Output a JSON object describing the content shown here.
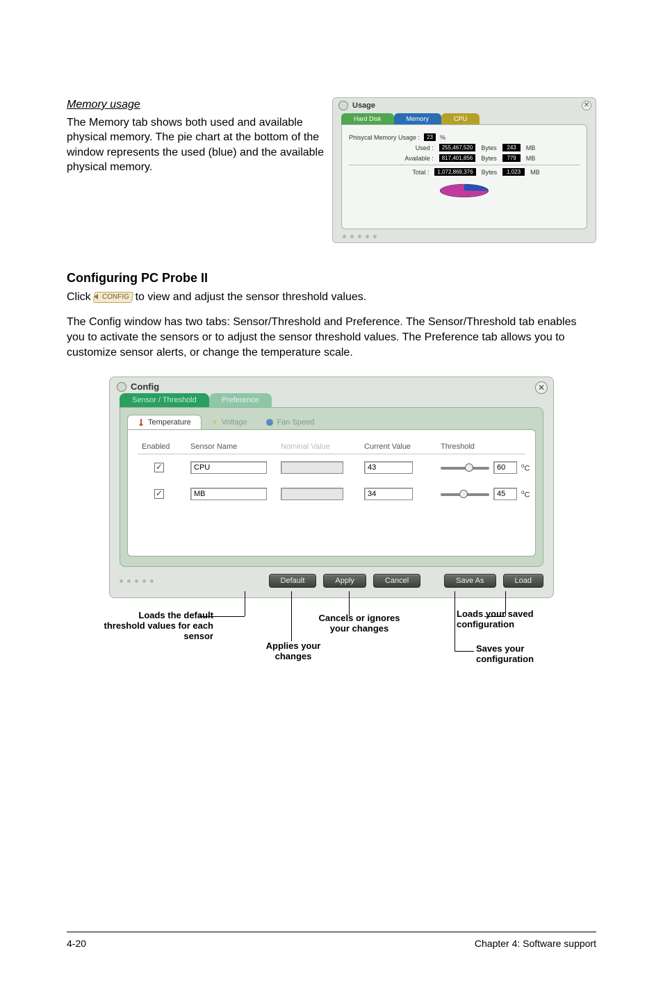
{
  "memory_section": {
    "heading": "Memory usage",
    "body": "The Memory tab shows both used and available physical memory. The pie chart at the bottom of the window represents the used (blue) and the available physical memory."
  },
  "usage_window": {
    "title": "Usage",
    "tabs": {
      "hard": "Hard Disk",
      "memory": "Memory",
      "cpu": "CPU"
    },
    "label_usage": "Phisycal Memory Usage :",
    "pct_box": "23",
    "pct_suffix": "%",
    "rows": {
      "used": {
        "label": "Used :",
        "bytes": "255,467,520",
        "unit1": "Bytes",
        "mb": "243",
        "unit2": "MB"
      },
      "available": {
        "label": "Available :",
        "bytes": "817,401,856",
        "unit1": "Bytes",
        "mb": "779",
        "unit2": "MB"
      },
      "total": {
        "label": "Total :",
        "bytes": "1,072,869,376",
        "unit1": "Bytes",
        "mb": "1,023",
        "unit2": "MB"
      }
    }
  },
  "configuring": {
    "heading": "Configuring PC Probe II",
    "click_pre": "Click",
    "config_btn": "CONFIG",
    "click_post": "to view and adjust the sensor threshold values.",
    "paragraph": "The Config window has two tabs: Sensor/Threshold and Preference. The Sensor/Threshold tab enables you to activate the sensors or to adjust the sensor threshold values. The Preference tab allows you to customize sensor alerts, or change the temperature scale."
  },
  "config_window": {
    "title": "Config",
    "outer_tabs": {
      "sensor": "Sensor / Threshold",
      "pref": "Preference"
    },
    "inner_tabs": {
      "temp": "Temperature",
      "volt": "Voltage",
      "fan": "Fan Speed"
    },
    "columns": {
      "enabled": "Enabled",
      "sensor": "Sensor Name",
      "nominal": "Nominal Value",
      "current": "Current Value",
      "threshold": "Threshold"
    },
    "rows": [
      {
        "name": "CPU",
        "current": "43",
        "threshold": "60",
        "unit": "C",
        "thumb_pct": 50
      },
      {
        "name": "MB",
        "current": "34",
        "threshold": "45",
        "unit": "C",
        "thumb_pct": 38
      }
    ],
    "buttons": {
      "default": "Default",
      "apply": "Apply",
      "cancel": "Cancel",
      "saveas": "Save As",
      "load": "Load"
    }
  },
  "annotations": {
    "loads_default": "Loads the default threshold values for each sensor",
    "applies": "Applies your changes",
    "cancels": "Cancels or ignores your changes",
    "loads_saved": "Loads your saved configuration",
    "saves": "Saves your configuration"
  },
  "footer": {
    "left": "4-20",
    "right": "Chapter 4: Software support"
  }
}
